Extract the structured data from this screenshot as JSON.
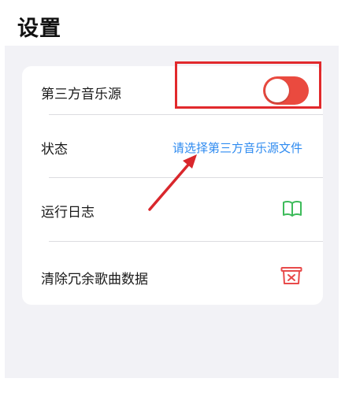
{
  "header": {
    "title": "设置"
  },
  "settings": {
    "items": [
      {
        "label": "第三方音乐源",
        "control": "toggle",
        "toggle_on": true
      },
      {
        "label": "状态",
        "value": "请选择第三方音乐源文件"
      },
      {
        "label": "运行日志",
        "icon": "book-icon"
      },
      {
        "label": "清除冗余歌曲数据",
        "icon": "trash-icon"
      }
    ]
  },
  "annotations": {
    "highlight_color": "#e1292c",
    "arrow_color": "#d9272c"
  },
  "colors": {
    "toggle_on": "#ea4a3f",
    "link": "#2f8bf0",
    "book_icon": "#3dbb5a",
    "trash_icon": "#e84a4a",
    "background": "#f2f2f6"
  }
}
